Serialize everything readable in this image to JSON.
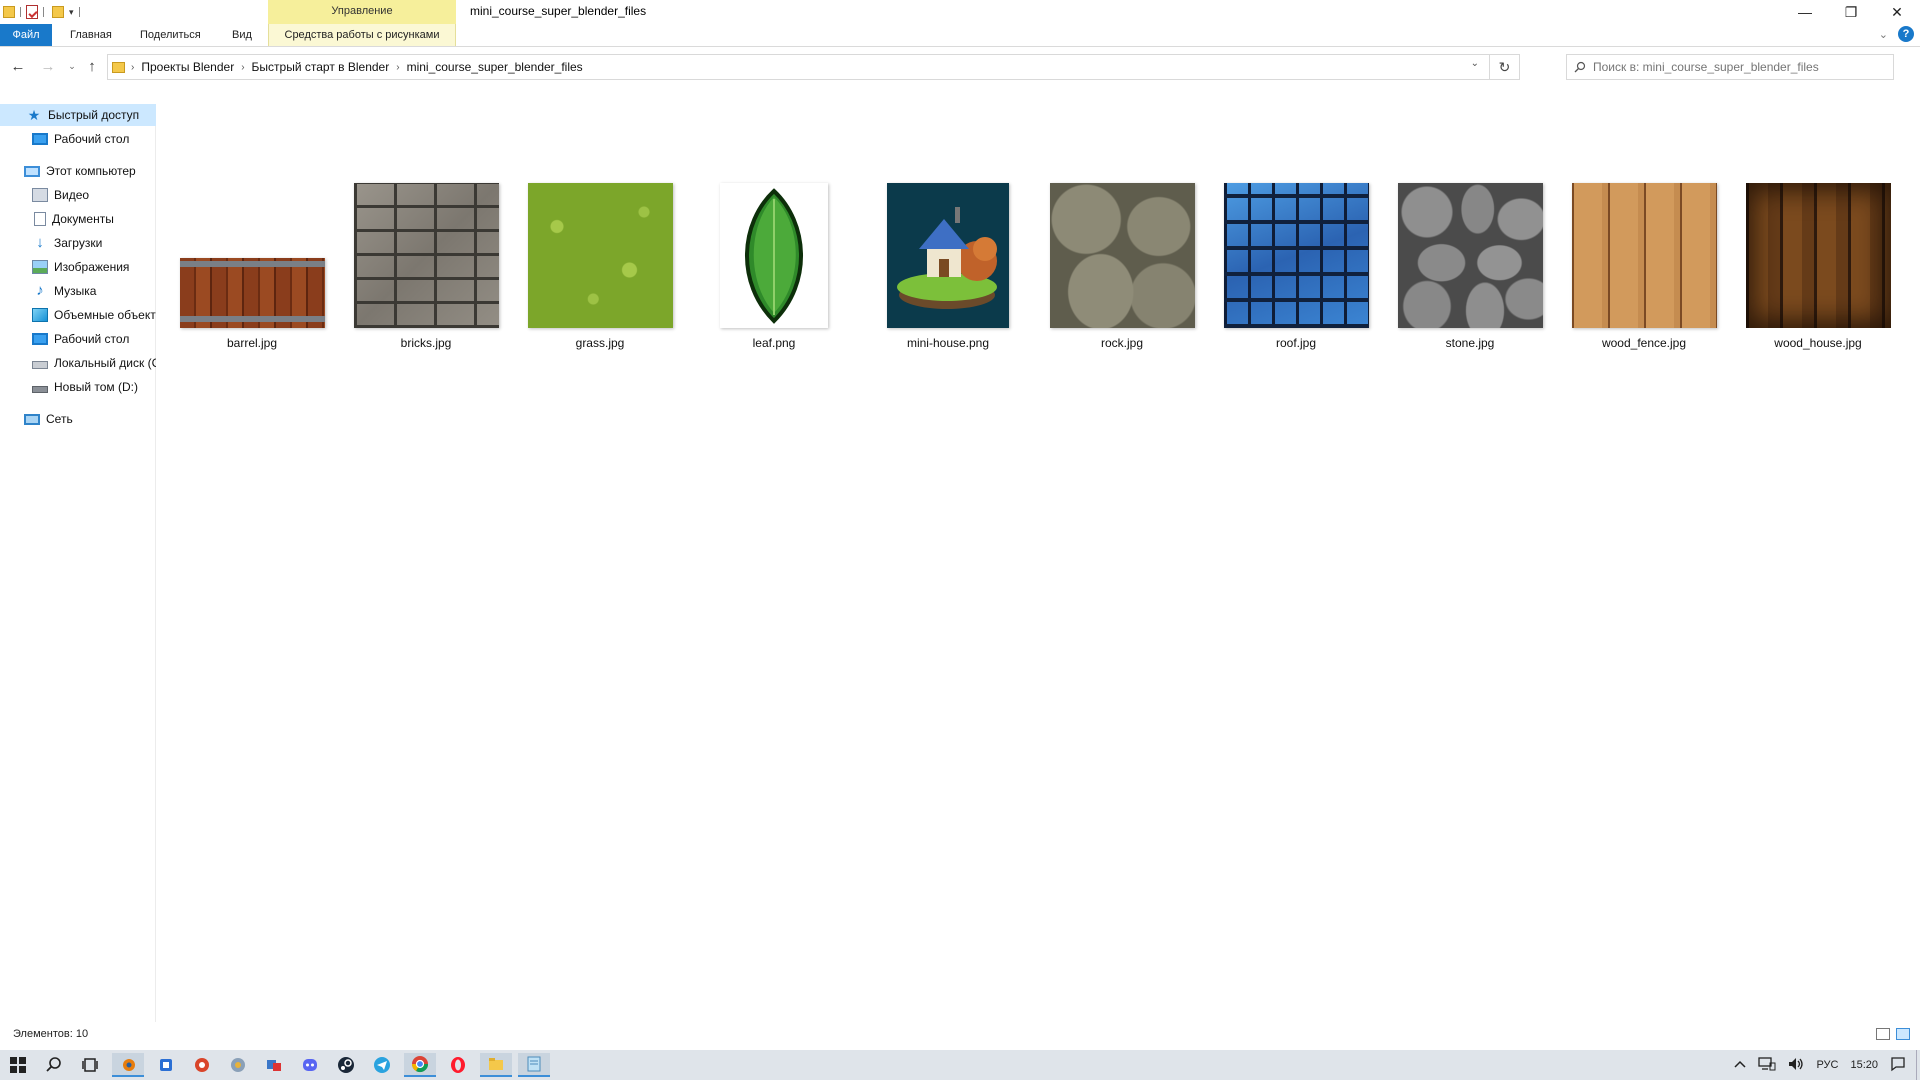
{
  "window": {
    "title": "mini_course_super_blender_files",
    "contextual_group": "Управление",
    "controls": {
      "minimize": "—",
      "restore": "❐",
      "close": "✕"
    }
  },
  "ribbon": {
    "tabs": [
      {
        "id": "file",
        "label": "Файл"
      },
      {
        "id": "home",
        "label": "Главная"
      },
      {
        "id": "share",
        "label": "Поделиться"
      },
      {
        "id": "view",
        "label": "Вид"
      },
      {
        "id": "picture-tools",
        "label": "Средства работы с рисунками"
      }
    ],
    "help": "?"
  },
  "address": {
    "crumbs": [
      "Проекты Blender",
      "Быстрый старт в Blender",
      "mini_course_super_blender_files"
    ],
    "search_placeholder": "Поиск в: mini_course_super_blender_files"
  },
  "sidebar": {
    "items": [
      {
        "label": "Быстрый доступ",
        "icon": "star-icon",
        "selected": true
      },
      {
        "label": "Рабочий стол",
        "icon": "desktop-icon"
      },
      {
        "label": "Этот компьютер",
        "icon": "computer-icon"
      },
      {
        "label": "Видео",
        "icon": "video-icon"
      },
      {
        "label": "Документы",
        "icon": "documents-icon"
      },
      {
        "label": "Загрузки",
        "icon": "download-icon"
      },
      {
        "label": "Изображения",
        "icon": "pictures-icon"
      },
      {
        "label": "Музыка",
        "icon": "music-icon"
      },
      {
        "label": "Объемные объекты",
        "icon": "3d-objects-icon"
      },
      {
        "label": "Рабочий стол",
        "icon": "desktop-icon"
      },
      {
        "label": "Локальный диск (C:)",
        "icon": "drive-icon"
      },
      {
        "label": "Новый том (D:)",
        "icon": "drive-icon"
      },
      {
        "label": "Сеть",
        "icon": "network-icon"
      }
    ]
  },
  "files": [
    {
      "name": "barrel.jpg",
      "texture": "barrel"
    },
    {
      "name": "bricks.jpg",
      "texture": "bricks"
    },
    {
      "name": "grass.jpg",
      "texture": "grass"
    },
    {
      "name": "leaf.png",
      "texture": "leaf"
    },
    {
      "name": "mini-house.png",
      "texture": "mini-house"
    },
    {
      "name": "rock.jpg",
      "texture": "rock"
    },
    {
      "name": "roof.jpg",
      "texture": "roof"
    },
    {
      "name": "stone.jpg",
      "texture": "stone"
    },
    {
      "name": "wood_fence.jpg",
      "texture": "wood-fence"
    },
    {
      "name": "wood_house.jpg",
      "texture": "wood-house"
    }
  ],
  "status": {
    "count": "Элементов: 10"
  },
  "tray": {
    "language": "РУС",
    "time": "15:20"
  },
  "colors": {
    "accent": "#1979ca",
    "selection": "#cce8ff",
    "contextual": "#f6ef9b"
  }
}
